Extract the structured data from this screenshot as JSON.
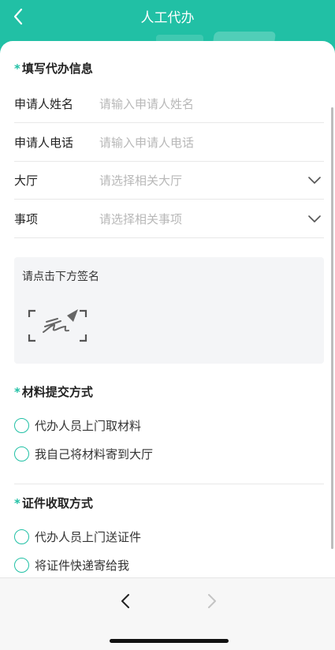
{
  "header": {
    "title": "人工代办",
    "back_icon": "chevron-left-icon",
    "background_color": "#21c0a5"
  },
  "form": {
    "section_info_title": "填写代办信息",
    "required_marker": "*",
    "fields": [
      {
        "label": "申请人姓名",
        "placeholder": "请输入申请人姓名",
        "value": ""
      },
      {
        "label": "申请人电话",
        "placeholder": "请输入申请人电话",
        "value": ""
      },
      {
        "label": "大厅",
        "placeholder": "请选择相关大厅",
        "icon": "chevron-down-icon"
      },
      {
        "label": "事项",
        "placeholder": "请选择相关事项",
        "icon": "chevron-down-icon"
      }
    ],
    "signature": {
      "hint": "请点击下方签名",
      "icon": "signature-icon"
    },
    "material_section": {
      "title": "材料提交方式",
      "options": [
        "代办人员上门取材料",
        "我自己将材料寄到大厅"
      ]
    },
    "certificate_section": {
      "title": "证件收取方式",
      "options": [
        "代办人员上门送证件",
        "将证件快递寄给我"
      ]
    }
  },
  "footer": {
    "back_icon": "chevron-left-icon",
    "forward_icon": "chevron-right-icon"
  }
}
